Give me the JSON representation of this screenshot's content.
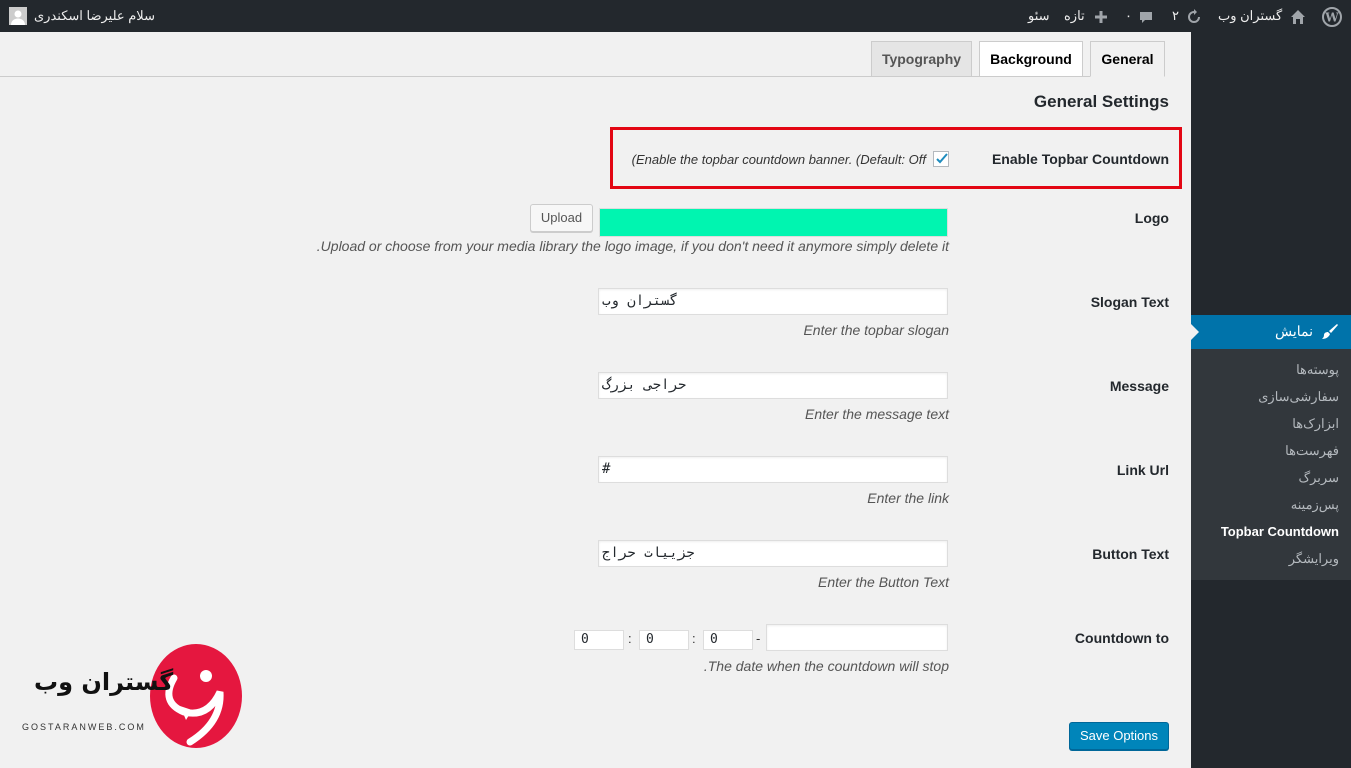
{
  "adminbar": {
    "site_name": "گستران وب",
    "updates_count": "۲",
    "comments_count": "۰",
    "new_label": "تازه",
    "seo_label": "سئو",
    "greeting": "سلام علیرضا اسکندری"
  },
  "sidebar": {
    "current_menu": "نمایش",
    "submenu": [
      "پوسته‌ها",
      "سفارشی‌سازی",
      "ابزارک‌ها",
      "فهرست‌ها",
      "سربرگ",
      "پس‌زمینه",
      "Topbar Countdown",
      "ویرایشگر"
    ],
    "current_submenu": "Topbar Countdown"
  },
  "tabs": [
    "Typography",
    "Background",
    "General"
  ],
  "section_title": "General Settings",
  "settings": {
    "enable": {
      "label": "Enable Topbar Countdown",
      "desc": "(Enable the topbar countdown banner. (Default: Off",
      "checked": true
    },
    "logo": {
      "label": "Logo",
      "upload_label": "Upload",
      "color": "#00f5b0",
      "desc": ".Upload or choose from your media library the logo image, if you don't need it anymore simply delete it"
    },
    "slogan": {
      "label": "Slogan Text",
      "value": "گستران وب",
      "desc": "Enter the topbar slogan"
    },
    "message": {
      "label": "Message",
      "value": "حراجی بزرگ",
      "desc": "Enter the message text"
    },
    "link": {
      "label": "Link Url",
      "value": "#",
      "desc": "Enter the link"
    },
    "button": {
      "label": "Button Text",
      "value": "جزییات حراج",
      "desc": "Enter the Button Text"
    },
    "countdown": {
      "label": "Countdown to",
      "date_value": "",
      "dash": "-",
      "colon": ":",
      "hour": "0",
      "minute": "0",
      "second": "0",
      "desc": ".The date when the countdown will stop"
    }
  },
  "save_label": "Save Options",
  "watermark": {
    "brand": "گستران وب",
    "domain": "GOSTARANWEB.COM"
  },
  "colors": {
    "accent": "#0073aa",
    "highlight_border": "#e30613",
    "logo_swatch": "#00f5b0"
  }
}
